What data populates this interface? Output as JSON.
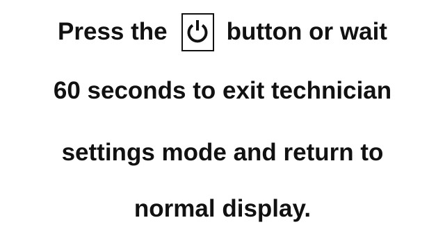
{
  "message": {
    "line1_before": "Press the",
    "line1_after": "button or wait",
    "line2": "60 seconds to exit technician",
    "line3": "settings mode and return to",
    "line4": "normal display."
  },
  "icon": {
    "name": "power-icon",
    "color": "#111111"
  }
}
